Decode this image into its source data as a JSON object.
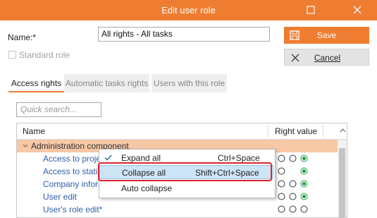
{
  "window": {
    "title": "Edit user role"
  },
  "form": {
    "name_label": "Name:*",
    "name_value": "All rights - All tasks",
    "standard_role_label": "Standard role",
    "standard_role_checked": false
  },
  "buttons": {
    "save": "Save",
    "cancel": "Cancel"
  },
  "tabs": [
    {
      "label": "Access rights",
      "active": true
    },
    {
      "label": "Automatic tasks rights",
      "active": false
    },
    {
      "label": "Users with this role",
      "active": false
    }
  ],
  "search": {
    "placeholder": "Quick search..."
  },
  "grid": {
    "columns": [
      "Name",
      "Right value"
    ],
    "group": "Administration component",
    "rows": [
      {
        "label": "Access to proje"
      },
      {
        "label": "Access to statis"
      },
      {
        "label": "Company inform"
      },
      {
        "label": "User edit"
      },
      {
        "label": "User's role edit*"
      }
    ]
  },
  "context_menu": {
    "items": [
      {
        "label": "Expand all",
        "shortcut": "Ctrl+Space",
        "checked": true,
        "highlighted": false
      },
      {
        "label": "Collapse all",
        "shortcut": "Shift+Ctrl+Space",
        "checked": false,
        "highlighted": true
      },
      {
        "label": "Auto collapse",
        "shortcut": "",
        "checked": false,
        "highlighted": false
      }
    ]
  },
  "colors": {
    "accent": "#ee7d31",
    "group_row": "#f7c8a6",
    "radio_selected": "#1a9c3e",
    "highlight_outline": "#d7262e"
  }
}
